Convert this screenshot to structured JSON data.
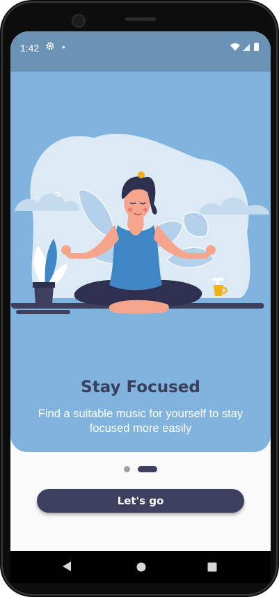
{
  "status_bar": {
    "time": "1:42",
    "settings_icon": "gear-icon",
    "notification_dot": "•",
    "wifi_icon": "wifi-icon",
    "signal_icon": "signal-icon",
    "battery_icon": "battery-icon"
  },
  "onboarding": {
    "illustration": "meditating-woman-illustration",
    "title": "Stay Focused",
    "subtitle": "Find a suitable music for yourself to stay focused more easily",
    "page_indicator": {
      "total_pages": 2,
      "current_page": 2
    }
  },
  "cta": {
    "label": "Let's go"
  },
  "colors": {
    "status_bar": "#6a93b5",
    "hero_background": "#80b3dd",
    "title": "#393f5c",
    "button": "#3e3f5e",
    "screen_background": "#fafafa"
  },
  "navigation_bar": {
    "back_icon": "back-triangle-icon",
    "home_icon": "home-circle-icon",
    "recents_icon": "recents-square-icon"
  }
}
